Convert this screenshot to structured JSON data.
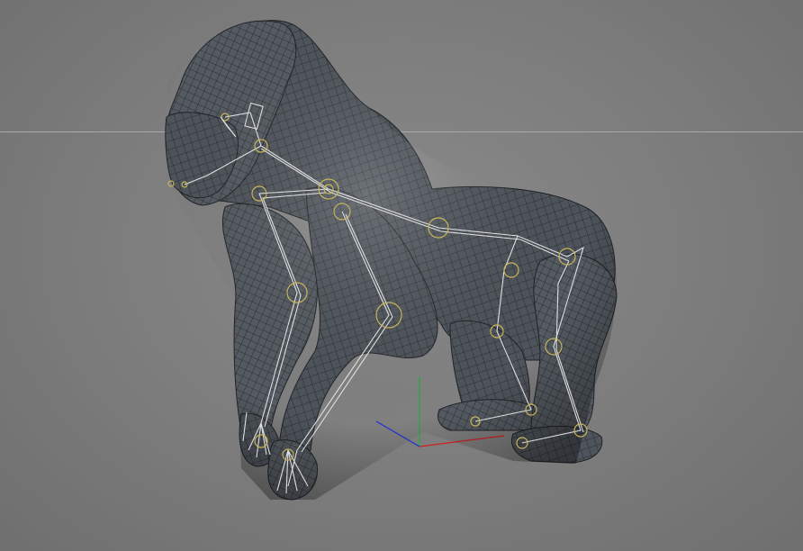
{
  "viewport": {
    "background_color": "#7b7b7b",
    "horizon_line_color": "#a9a9a9",
    "model_subject": "gorilla",
    "mesh_display": "wireframe-on-shaded",
    "mesh_fill_color": "#4e545b",
    "mesh_wire_color": "#1f2226",
    "bone_color": "#e6e6e6",
    "joint_color": "#c8b55a",
    "world_axis": {
      "x_color": "#d02020",
      "y_color": "#20b040",
      "z_color": "#2030d0"
    }
  }
}
